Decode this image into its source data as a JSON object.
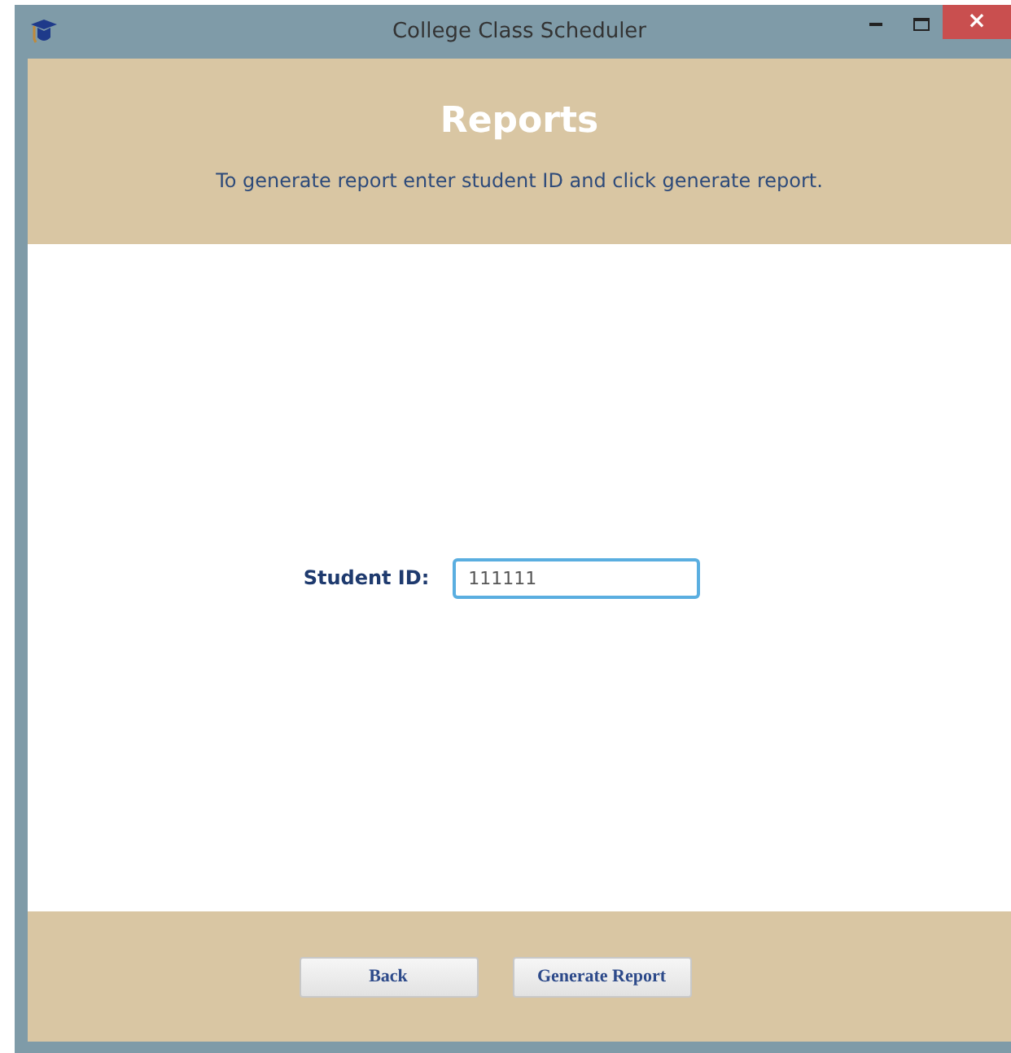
{
  "window": {
    "title": "College Class Scheduler",
    "close": "×"
  },
  "header": {
    "title": "Reports",
    "instruction": "To generate report enter student ID and click generate report."
  },
  "form": {
    "label": "Student ID:",
    "value": "111111",
    "focused": true
  },
  "buttons": [
    "Back",
    "Generate Report"
  ]
}
